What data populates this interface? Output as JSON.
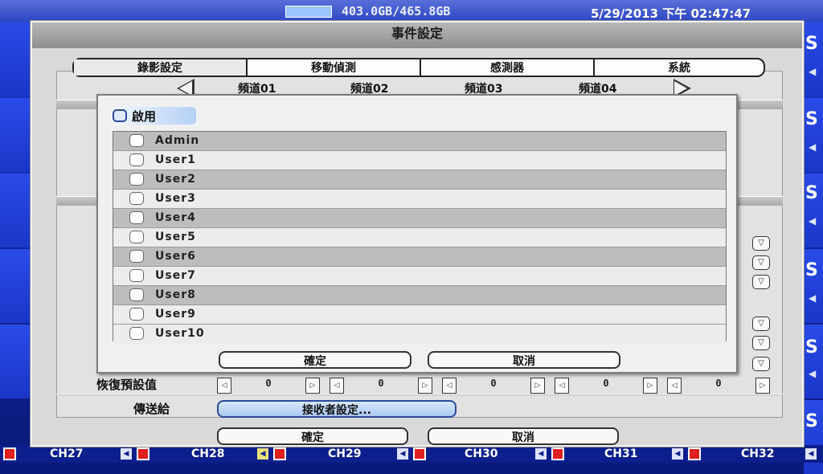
{
  "status": {
    "hdd": "403.0GB/465.8GB",
    "datetime": "5/29/2013 下午 02:47:47"
  },
  "dialog": {
    "title": "事件設定",
    "tabs": [
      "錄影設定",
      "移動偵測",
      "感測器",
      "系統"
    ],
    "channels": [
      "頻道01",
      "頻道02",
      "頻道03",
      "頻道04"
    ],
    "restore_label": "恢復預設值",
    "restore_values": [
      "0",
      "0",
      "0",
      "0"
    ],
    "sendto_label": "傳送給",
    "receiver_button": "接收者設定...",
    "ok": "確定",
    "cancel": "取消"
  },
  "popup": {
    "enable_label": "啟用",
    "users": [
      "Admin",
      "User1",
      "User2",
      "User3",
      "User4",
      "User5",
      "User6",
      "User7",
      "User8",
      "User9",
      "User10"
    ],
    "ok": "確定",
    "cancel": "取消"
  },
  "bottom": {
    "channels": [
      "CH27",
      "CH28",
      "CH29",
      "CH30",
      "CH31",
      "CH32"
    ]
  },
  "colors": {
    "accent": "#a9c8f0",
    "background_blue": "#1d3bd6",
    "record_red": "#e02020"
  }
}
